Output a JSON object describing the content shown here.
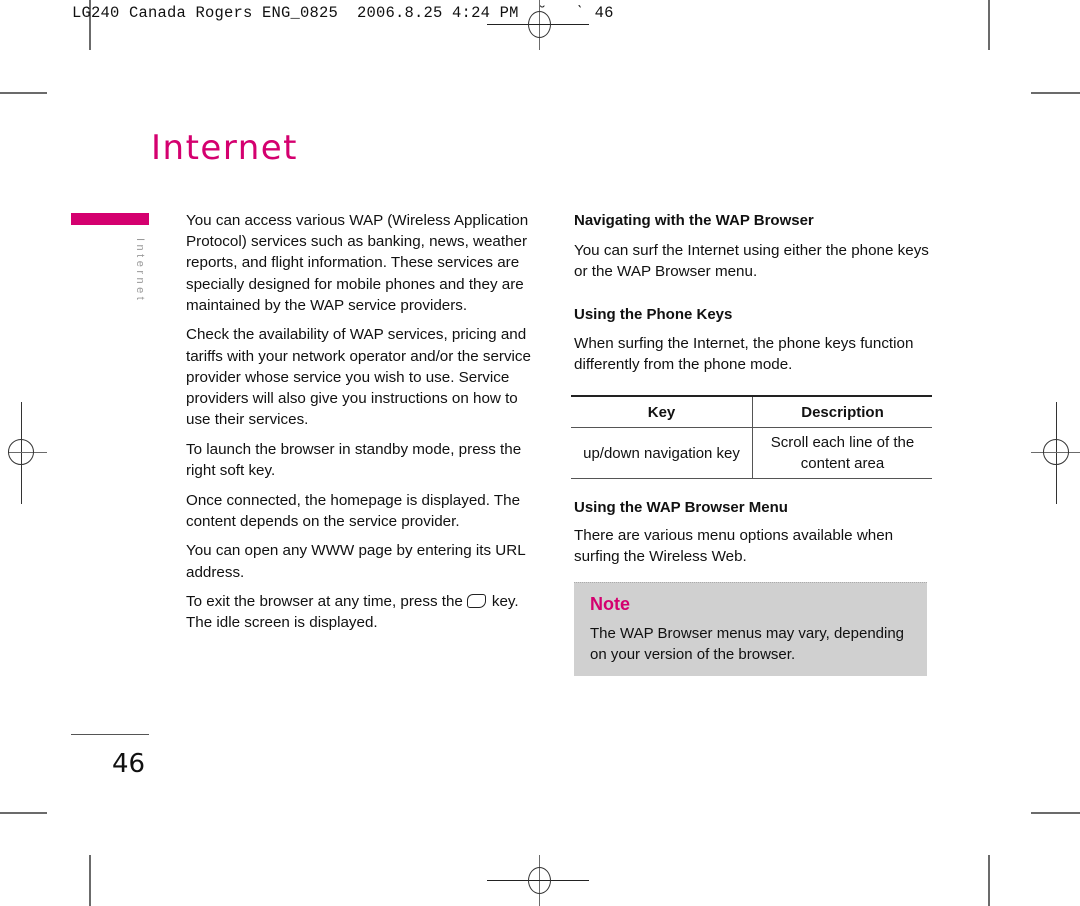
{
  "print_header": {
    "text": "LG240 Canada Rogers ENG_0825  2006.8.25 4:24 PM  ˘   ˋ 46"
  },
  "page": {
    "title": "Internet",
    "side_tab_label": "Internet",
    "number": "46",
    "accent_color": "#d4006f"
  },
  "left_column": {
    "paragraphs": [
      "You can access various WAP (Wireless Application Protocol) services such as banking, news, weather reports, and flight information. These services are specially designed for mobile phones and they are maintained by the WAP service providers.",
      "Check the availability of WAP services, pricing and tariffs with your network  operator and/or the service provider whose service you wish to use. Service providers will also give you instructions on how to use their services.",
      "To launch the browser in standby mode, press the right soft key.",
      "Once connected, the homepage is displayed. The content depends on the service provider.",
      "You can open any WWW page by entering its URL address."
    ],
    "exit_paragraph": {
      "before_icon": "To exit the browser at any time, press the",
      "icon": "end-key-icon",
      "after_icon": "key. The idle screen is displayed."
    }
  },
  "right_column": {
    "section1": {
      "heading": "Navigating with the WAP Browser",
      "text": "You can surf the Internet using either the phone keys or the WAP Browser menu."
    },
    "section2": {
      "heading": "Using the Phone Keys",
      "text": "When surfing the Internet, the phone keys function differently from the phone mode."
    },
    "key_table": {
      "headers": [
        "Key",
        "Description"
      ],
      "rows": [
        [
          "up/down navigation key",
          "Scroll each line of the content area"
        ]
      ]
    },
    "section3": {
      "heading": "Using the WAP Browser Menu",
      "text": "There are various menu options available when surfing the Wireless Web."
    },
    "note": {
      "title": "Note",
      "text": "The WAP Browser menus may vary, depending on your version of the browser."
    }
  }
}
